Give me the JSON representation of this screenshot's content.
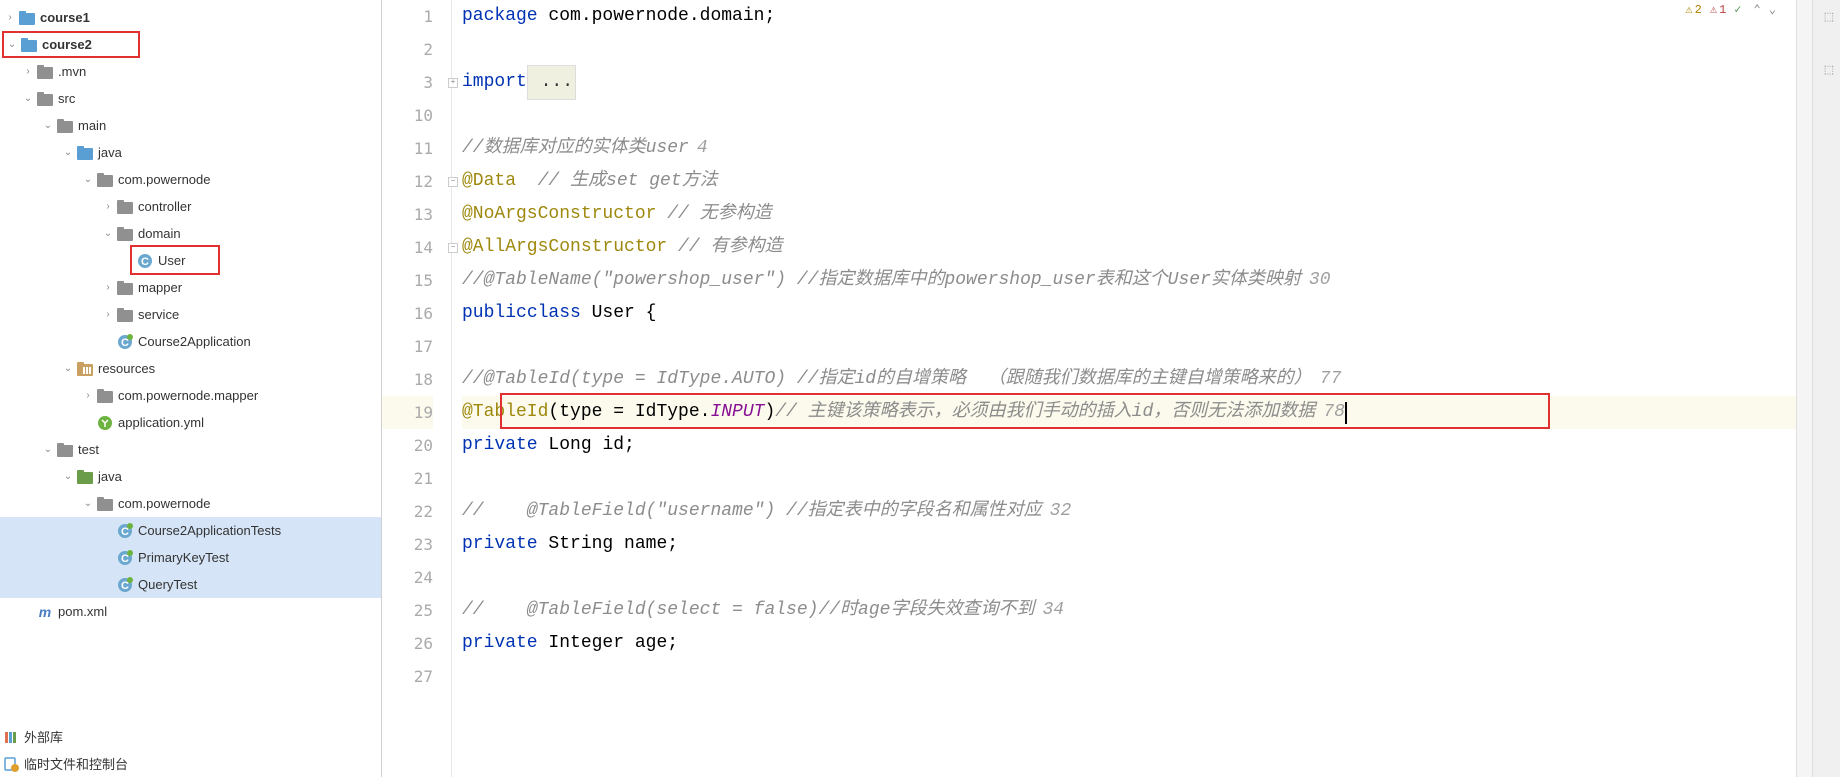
{
  "tree": {
    "course1": "course1",
    "course2": "course2",
    "mvn": ".mvn",
    "src": "src",
    "main": "main",
    "java": "java",
    "pkg": "com.powernode",
    "controller": "controller",
    "domain": "domain",
    "user": "User",
    "mapper": "mapper",
    "service": "service",
    "app": "Course2Application",
    "resources": "resources",
    "mapperRes": "com.powernode.mapper",
    "appyml": "application.yml",
    "test": "test",
    "javaTest": "java",
    "pkgTest": "com.powernode",
    "appTests": "Course2ApplicationTests",
    "pkTest": "PrimaryKeyTest",
    "qTest": "QueryTest",
    "pom": "pom.xml",
    "extLib": "外部库",
    "scratch": "临时文件和控制台"
  },
  "gutter": [
    "1",
    "2",
    "3",
    "10",
    "11",
    "12",
    "13",
    "14",
    "15",
    "16",
    "17",
    "18",
    "19",
    "20",
    "21",
    "22",
    "23",
    "24",
    "25",
    "26",
    "27"
  ],
  "code": {
    "l1_kw": "package",
    "l1_rest": " com.powernode.domain;",
    "l3_kw": "import",
    "l3_rest": " ...",
    "l11": "//数据库对应的实体类user",
    "l11_inlay": "4",
    "l12_anno": "@Data",
    "l12_c": "  // 生成set get方法",
    "l13_anno": "@NoArgsConstructor",
    "l13_c": " // 无参构造",
    "l14_anno": "@AllArgsConstructor",
    "l14_c": " // 有参构造",
    "l15": "//@TableName(\"powershop_user\") //指定数据库中的powershop_user表和这个User实体类映射",
    "l15_inlay": "30",
    "l16_kw1": "public",
    "l16_kw2": "class",
    "l16_name": " User {",
    "l18": "//@TableId(type = IdType.AUTO) //指定id的自增策略  （跟随我们数据库的主键自增策略来的）",
    "l18_inlay": "77",
    "l19_anno": "@TableId",
    "l19_p1": "(type = IdType.",
    "l19_p2": "INPUT",
    "l19_p3": ")",
    "l19_c": "// 主键该策略表示，必须由我们手动的插入id，否则无法添加数据",
    "l19_inlay": "78",
    "l20_kw": "private",
    "l20_type": " Long ",
    "l20_name": "id;",
    "l22": "//    @TableField(\"username\") //指定表中的字段名和属性对应",
    "l22_inlay": "32",
    "l23_kw": "private",
    "l23_type": " String ",
    "l23_name": "name;",
    "l25": "//    @TableField(select = false)//时age字段失效查询不到",
    "l25_inlay": "34",
    "l26_kw": "private",
    "l26_type": " Integer ",
    "l26_name": "age;"
  },
  "badges": {
    "warn": "2",
    "err": "1",
    "ok": ""
  }
}
